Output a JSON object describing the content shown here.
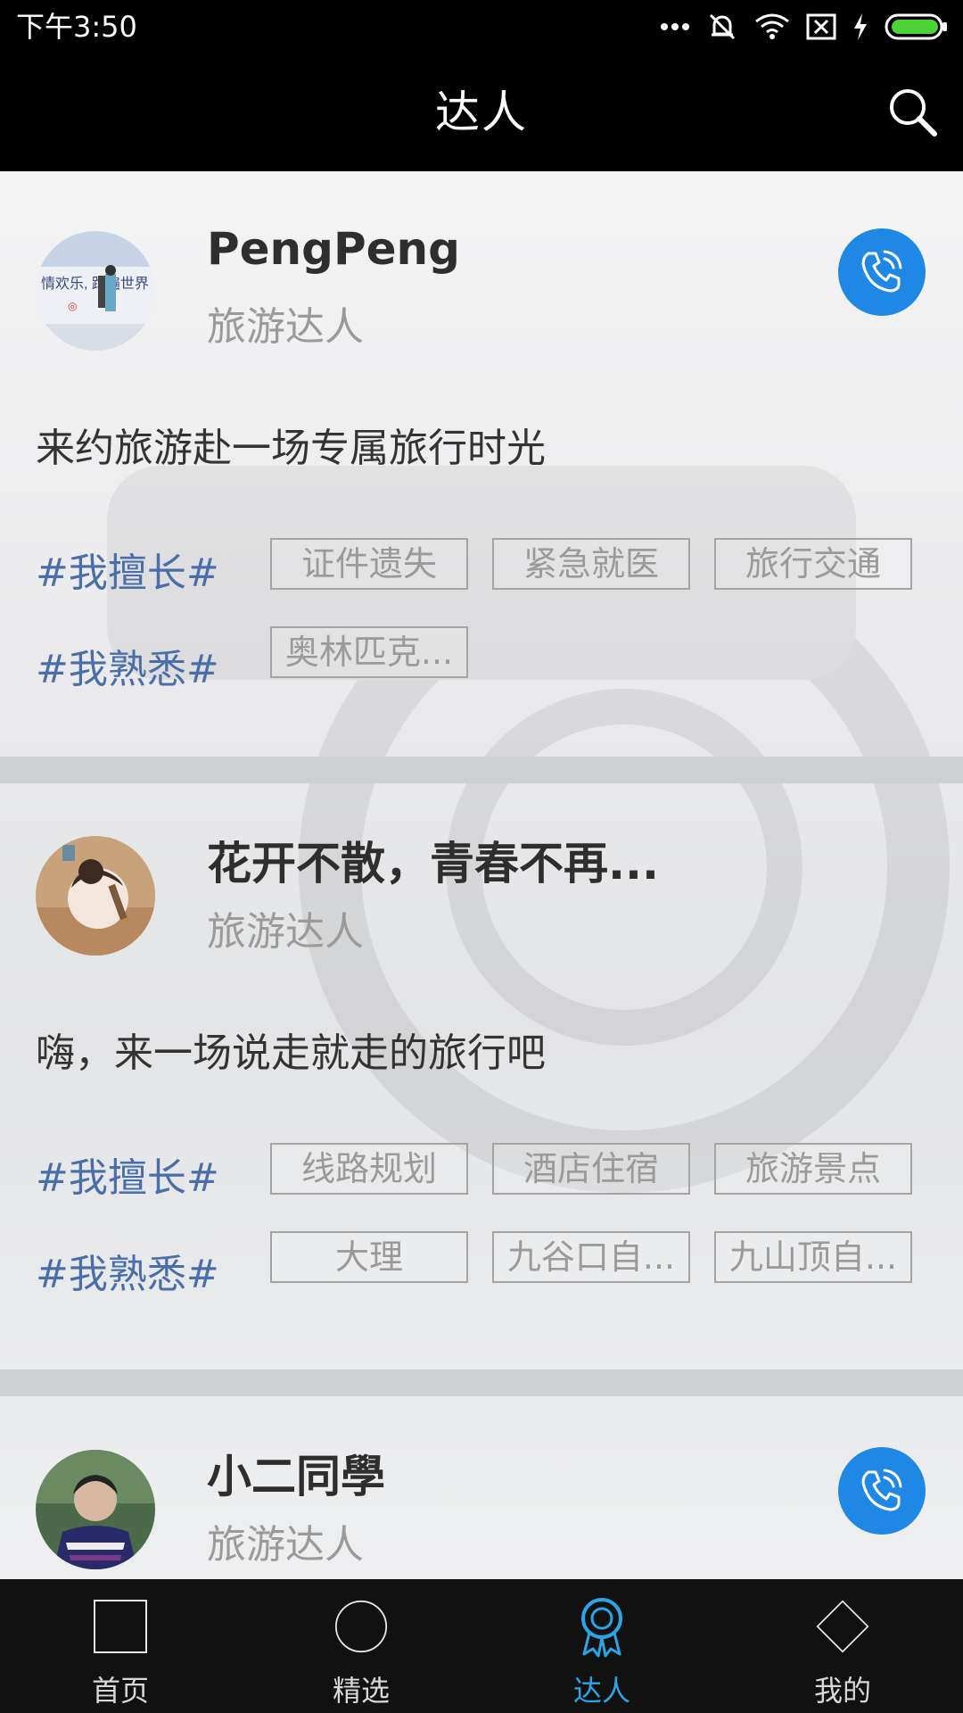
{
  "status_bar": {
    "time": "下午3:50"
  },
  "app_bar": {
    "title": "达人"
  },
  "experts": [
    {
      "name": "PengPeng",
      "role": "旅游达人",
      "motto": "来约旅游赴一场专属旅行时光",
      "has_call_button": true,
      "good_at_label": "#我擅长#",
      "good_at": [
        "证件遗失",
        "紧急就医",
        "旅行交通"
      ],
      "familiar_label": "#我熟悉#",
      "familiar": [
        "奥林匹克..."
      ]
    },
    {
      "name": "花开不散，青春不再...",
      "role": "旅游达人",
      "motto": "嗨，来一场说走就走的旅行吧",
      "has_call_button": false,
      "good_at_label": "#我擅长#",
      "good_at": [
        "线路规划",
        "酒店住宿",
        "旅游景点"
      ],
      "familiar_label": "#我熟悉#",
      "familiar": [
        "大理",
        "九谷口自...",
        "九山顶自..."
      ]
    },
    {
      "name": "小二同學",
      "role": "旅游达人",
      "has_call_button": true
    }
  ],
  "bottom_nav": [
    {
      "label": "首页",
      "icon": "square-icon",
      "active": false
    },
    {
      "label": "精选",
      "icon": "circle-icon",
      "active": false
    },
    {
      "label": "达人",
      "icon": "award-medal-icon",
      "active": true
    },
    {
      "label": "我的",
      "icon": "diamond-icon",
      "active": false
    }
  ],
  "colors": {
    "accent": "#2aa6e6",
    "call_button": "#1f88e5",
    "tag_label": "#4a6fa8",
    "bar_bg": "#000000",
    "nav_bg": "#111111"
  }
}
